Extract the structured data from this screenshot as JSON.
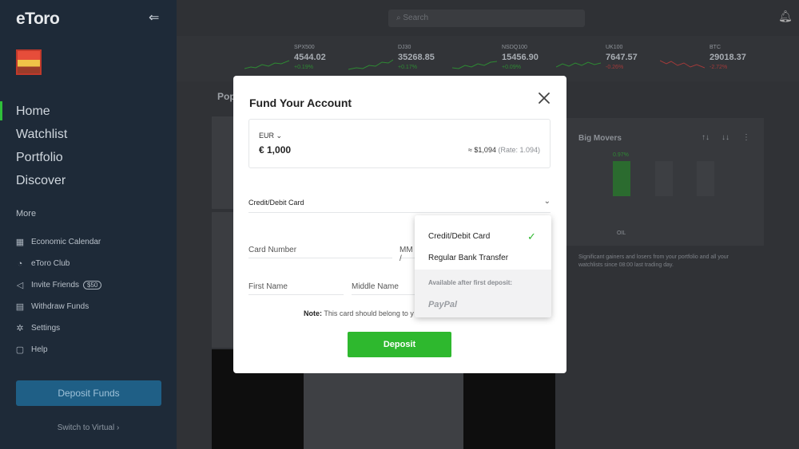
{
  "sidebar": {
    "logo": "eToro",
    "nav": [
      "Home",
      "Watchlist",
      "Portfolio",
      "Discover"
    ],
    "more_title": "More",
    "more": [
      {
        "icon": "calendar-icon",
        "glyph": "▦",
        "label": "Economic Calendar"
      },
      {
        "icon": "club-icon",
        "glyph": "◔",
        "label": "eToro Club"
      },
      {
        "icon": "megaphone-icon",
        "glyph": "◁",
        "label": "Invite Friends",
        "badge": "$50"
      },
      {
        "icon": "wallet-icon",
        "glyph": "▤",
        "label": "Withdraw Funds"
      },
      {
        "icon": "gear-icon",
        "glyph": "✲",
        "label": "Settings"
      },
      {
        "icon": "help-icon",
        "glyph": "▢",
        "label": "Help"
      }
    ],
    "deposit_funds": "Deposit Funds",
    "switch_virtual": "Switch to Virtual ›"
  },
  "topbar": {
    "search_placeholder": "Search"
  },
  "tickers": [
    {
      "symbol": "SPX500",
      "price": "4544.02",
      "change": "+0.19%",
      "trend": "up"
    },
    {
      "symbol": "DJ30",
      "price": "35268.85",
      "change": "+0.17%",
      "trend": "up"
    },
    {
      "symbol": "NSDQ100",
      "price": "15456.90",
      "change": "+0.09%",
      "trend": "up"
    },
    {
      "symbol": "UK100",
      "price": "7647.57",
      "change": "-0.26%",
      "trend": "down"
    },
    {
      "symbol": "BTC",
      "price": "29018.37",
      "change": "-2.72%",
      "trend": "down"
    }
  ],
  "background": {
    "popular_label": "Pop",
    "movers_title": "Big Movers",
    "mover_pct": "0.97%",
    "mover_label": "OIL",
    "movers_note": "Significant gainers and losers from your portfolio and all your watchlists since 08:00 last trading day."
  },
  "modal": {
    "title": "Fund Your Account",
    "currency": "EUR",
    "amount": "€ 1,000",
    "converted": "≈ $1,094",
    "rate": "(Rate: 1.094)",
    "method_selected": "Credit/Debit Card",
    "card_number_placeholder": "Card Number",
    "expiry_placeholder": "MM /",
    "first_name_placeholder": "First Name",
    "middle_name_placeholder": "Middle Name",
    "note_bold": "Note:",
    "note_text": "This card should belong to y",
    "deposit_button": "Deposit"
  },
  "dropdown": {
    "options": [
      "Credit/Debit Card",
      "Regular Bank Transfer"
    ],
    "selected_index": 0,
    "available_after": "Available after first deposit:",
    "paypal": "PayPal"
  },
  "colors": {
    "accent_green": "#2eb82e",
    "sidebar_bg": "#1e2a38",
    "modal_bg": "#ffffff",
    "negative": "#d23a3a"
  }
}
